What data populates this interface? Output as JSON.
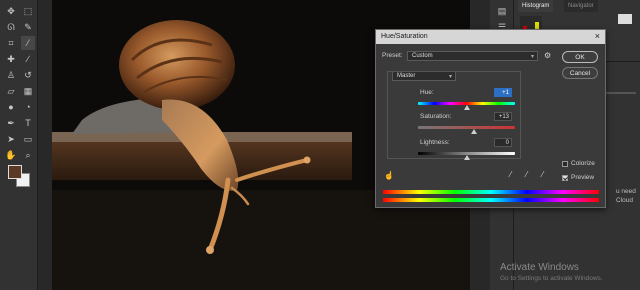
{
  "dialog": {
    "title": "Hue/Saturation",
    "preset_label": "Preset:",
    "preset_value": "Custom",
    "channel_value": "Master",
    "hue_label": "Hue:",
    "hue_value": "+1",
    "saturation_label": "Saturation:",
    "saturation_value": "+13",
    "lightness_label": "Lightness:",
    "lightness_value": "0",
    "ok_label": "OK",
    "cancel_label": "Cancel",
    "colorize_label": "Colorize",
    "preview_label": "Preview",
    "close_glyph": "×"
  },
  "panels": {
    "tab_histogram": "Histogram",
    "tab_navigator": "Navigator",
    "side_text_1": "u need",
    "side_text_2": "Cloud"
  },
  "watermark": {
    "line1": "Activate Windows",
    "line2": "Go to Settings to activate Windows."
  },
  "colors": {
    "foreground": "#5a3a24",
    "background": "#f2f2f2",
    "highlight": "#2d6fc5"
  },
  "icons": [
    "move-icon",
    "marquee-icon",
    "lasso-icon",
    "quick-select-icon",
    "crop-icon",
    "eyedropper-icon",
    "healing-icon",
    "brush-icon",
    "clone-stamp-icon",
    "history-brush-icon",
    "eraser-icon",
    "gradient-icon",
    "blur-icon",
    "dodge-icon",
    "pen-icon",
    "type-icon",
    "path-select-icon",
    "shape-icon",
    "hand-icon",
    "zoom-icon"
  ]
}
